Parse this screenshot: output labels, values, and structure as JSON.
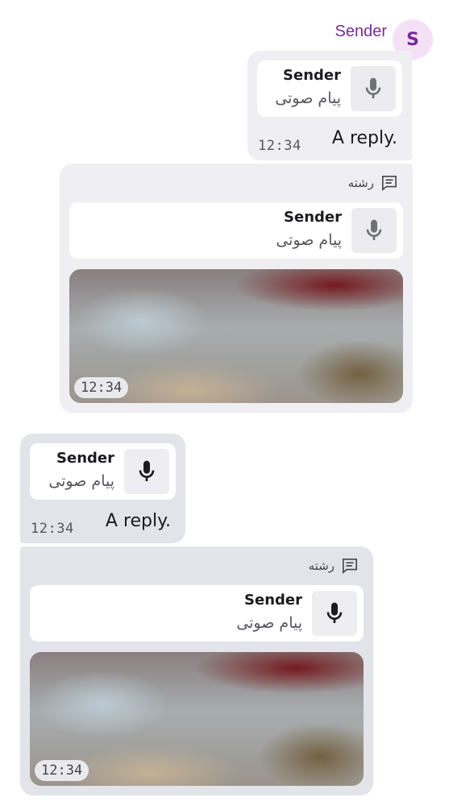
{
  "header": {
    "sender_name": "Sender",
    "avatar_letter": "S"
  },
  "messages": [
    {
      "reply_sender": "Sender",
      "reply_preview": "پیام صوتی",
      "text": "A reply.",
      "time": "12:34"
    },
    {
      "thread_label": "رشته",
      "reply_sender": "Sender",
      "reply_preview": "پیام صوتی",
      "media_time": "12:34"
    },
    {
      "reply_sender": "Sender",
      "reply_preview": "پیام صوتی",
      "text": "A reply.",
      "time": "12:34"
    },
    {
      "thread_label": "رشته",
      "reply_sender": "Sender",
      "reply_preview": "پیام صوتی",
      "media_time": "12:34"
    }
  ],
  "icons": {
    "mic": "mic-icon",
    "thread": "thread-icon"
  },
  "colors": {
    "sender": "#7b2a95",
    "avatar_bg": "#f4e1f6",
    "bubble_out": "#efeff3",
    "bubble_in": "#e2e4ea"
  }
}
